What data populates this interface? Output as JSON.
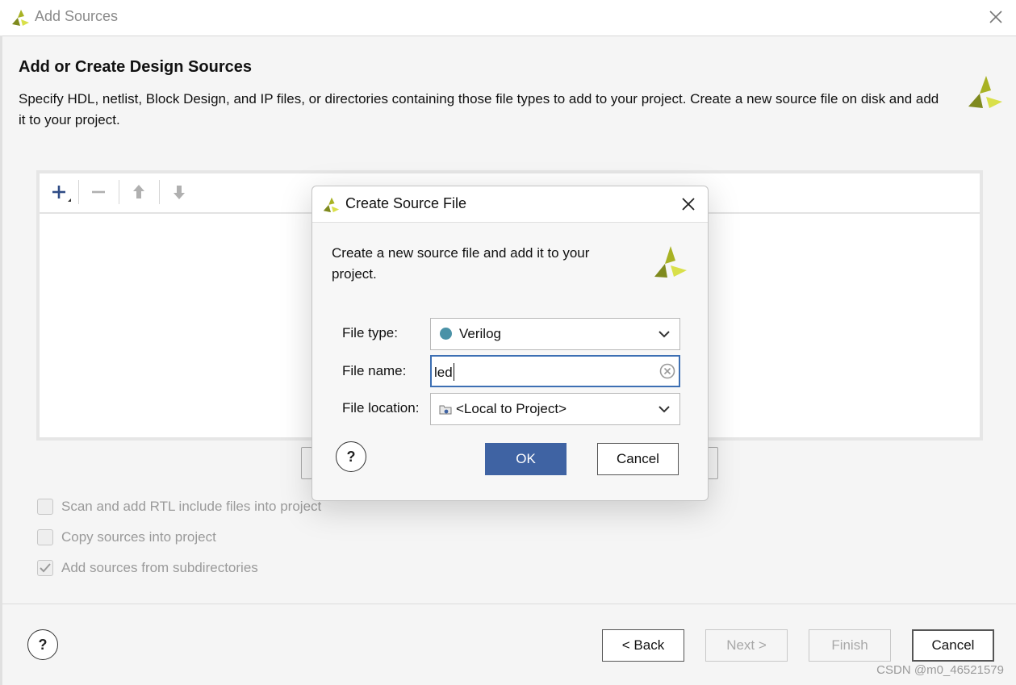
{
  "window": {
    "title": "Add Sources",
    "heading": "Add or Create Design Sources",
    "description": "Specify HDL, netlist, Block Design, and IP files, or directories containing those file types to add to your project. Create a new source file on disk and add it to your project."
  },
  "toolbar": {
    "icons": [
      "add-icon",
      "remove-icon",
      "move-up-icon",
      "move-down-icon"
    ]
  },
  "options": [
    {
      "label": "Scan and add RTL include files into project",
      "checked": false
    },
    {
      "label": "Copy sources into project",
      "checked": false
    },
    {
      "label": "Add sources from subdirectories",
      "checked": true
    }
  ],
  "footer": {
    "help": "?",
    "back": "< Back",
    "next": "Next >",
    "finish": "Finish",
    "cancel": "Cancel"
  },
  "dialog": {
    "title": "Create Source File",
    "description": "Create a new source file and add it to your project.",
    "file_type_label": "File type:",
    "file_type_value": "Verilog",
    "file_name_label": "File name:",
    "file_name_value": "led",
    "file_location_label": "File location:",
    "file_location_value": "<Local to Project>",
    "help": "?",
    "ok": "OK",
    "cancel": "Cancel"
  },
  "watermark": "CSDN @m0_46521579",
  "colors": {
    "primary_button": "#3f63a3",
    "logo_dark": "#7f8a1e",
    "logo_light": "#d9e04a",
    "verilog_dot": "#4a92a7",
    "focus_border": "#3d6fb3"
  }
}
